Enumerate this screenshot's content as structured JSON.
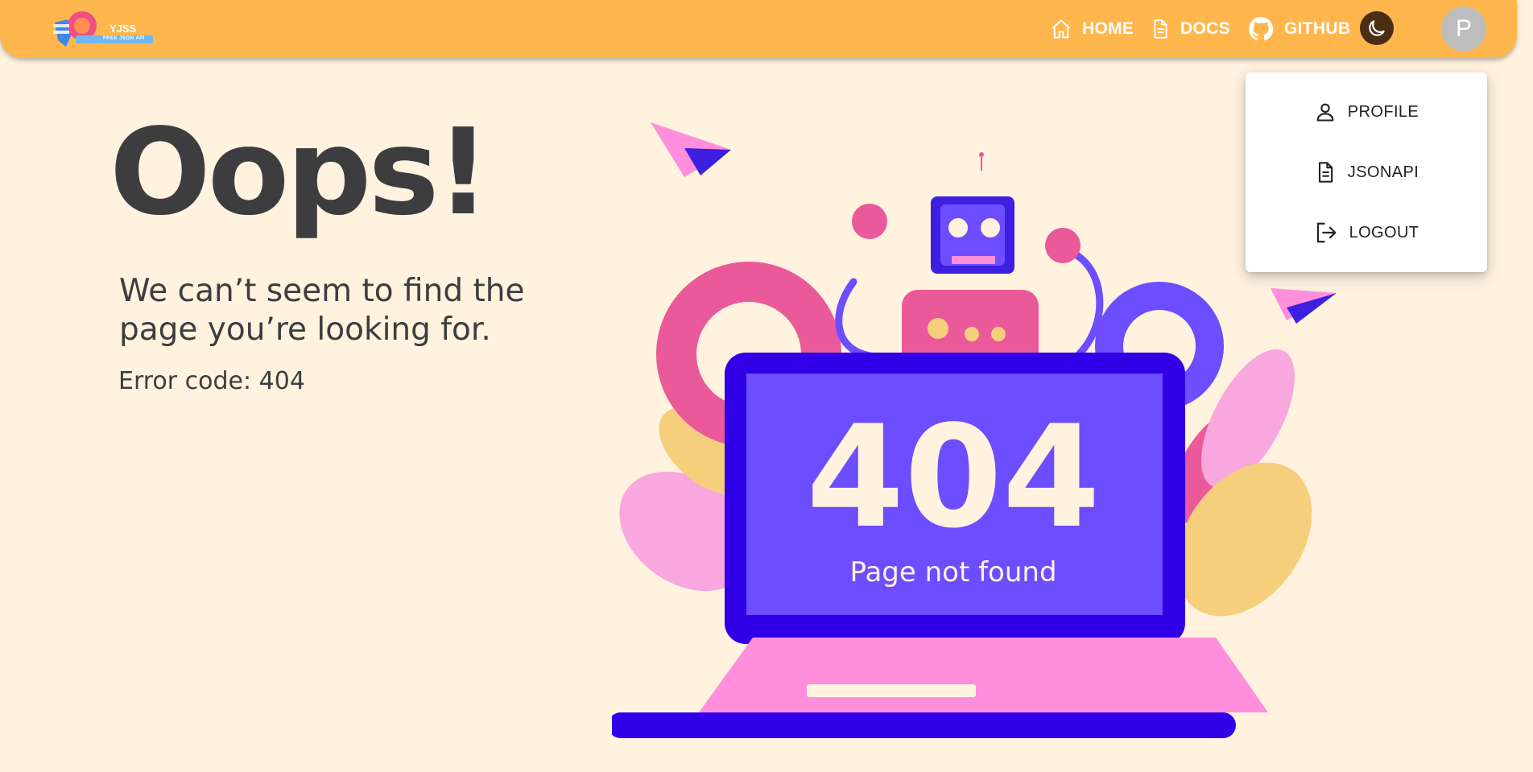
{
  "navbar": {
    "logo_text": "YJSS",
    "logo_subtext": "FREE JSON API",
    "home_label": "HOME",
    "docs_label": "DOCS",
    "github_label": "GITHUB",
    "avatar_letter": "P"
  },
  "user_menu": {
    "items": [
      {
        "label": "PROFILE",
        "icon": "person-icon"
      },
      {
        "label": "JSONAPI",
        "icon": "document-icon"
      },
      {
        "label": "LOGOUT",
        "icon": "logout-icon"
      }
    ]
  },
  "main": {
    "heading": "Oops!",
    "subtitle": "We can’t seem to find the page you’re looking for.",
    "error_code": "Error code: 404"
  },
  "illustration": {
    "code_text": "404",
    "caption": "Page not found"
  },
  "colors": {
    "background": "#fff2df",
    "navbar": "#ffb74d",
    "text": "#3d3d3f",
    "laptop": "#3200e6",
    "screen": "#6c4dff",
    "accent_pink": "#f05aa4"
  }
}
